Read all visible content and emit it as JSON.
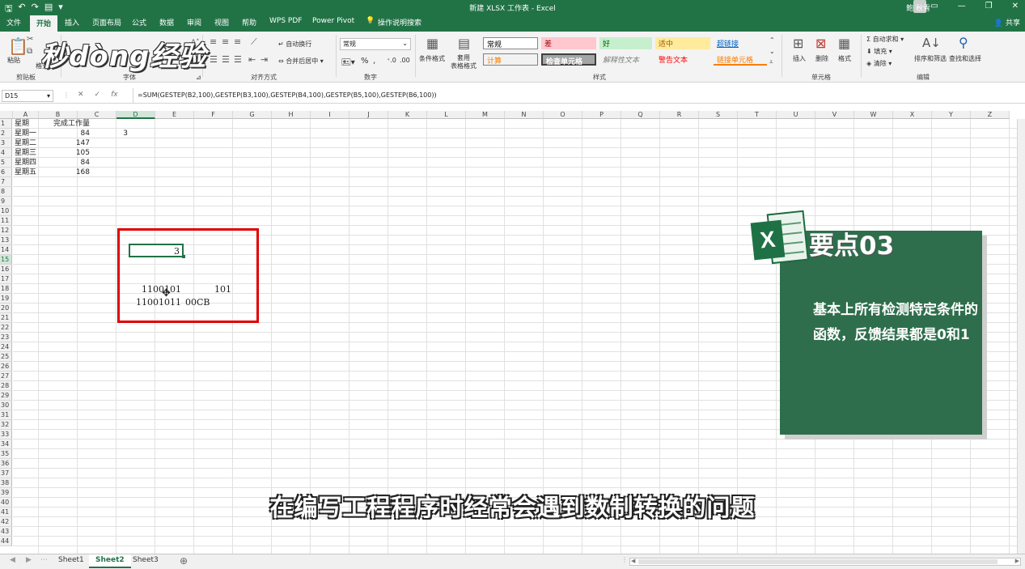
{
  "titlebar": {
    "doc_title": "新建 XLSX 工作表 - Excel",
    "user": "鲍 秋雪",
    "qat_icons": [
      "save-icon",
      "undo-icon",
      "redo-icon",
      "form-icon",
      "customize-icon"
    ]
  },
  "tabs": [
    "文件",
    "开始",
    "插入",
    "页面布局",
    "公式",
    "数据",
    "审阅",
    "视图",
    "帮助",
    "WPS PDF",
    "Power Pivot"
  ],
  "active_tab": "开始",
  "tell_me": "操作说明搜索",
  "share": "共享",
  "ribbon": {
    "groups": {
      "clipboard": "剪贴板",
      "font": "字体",
      "alignment": "对齐方式",
      "number": "数字",
      "styles": "样式",
      "cells": "单元格",
      "editing": "编辑"
    },
    "paste": "粘贴",
    "format_painter": "格式刷",
    "wrap_text": "自动换行",
    "merge_center": "合并后居中",
    "number_format": "常规",
    "conditional_format": "条件格式",
    "table_format": "套用\n表格格式",
    "style_cells": [
      {
        "label": "常规",
        "bg": "#ffffff",
        "color": "#000000"
      },
      {
        "label": "差",
        "bg": "#ffc7ce",
        "color": "#9c0006"
      },
      {
        "label": "好",
        "bg": "#c6efce",
        "color": "#006100"
      },
      {
        "label": "适中",
        "bg": "#ffeb9c",
        "color": "#9c5700"
      },
      {
        "label": "超链接",
        "bg": "#f3f3f3",
        "color": "#0563c1"
      },
      {
        "label": "计算",
        "bg": "#f2f2f2",
        "color": "#fa7d00"
      },
      {
        "label": "检查单元格",
        "bg": "#a5a5a5",
        "color": "#ffffff"
      },
      {
        "label": "解释性文本",
        "bg": "#f3f3f3",
        "color": "#7f7f7f"
      },
      {
        "label": "警告文本",
        "bg": "#f3f3f3",
        "color": "#ff0000"
      },
      {
        "label": "链接单元格",
        "bg": "#f3f3f3",
        "color": "#fa7d00"
      }
    ],
    "insert": "插入",
    "delete": "删除",
    "format": "格式",
    "autosum": "自动求和",
    "fill": "填充",
    "clear": "清除",
    "sort_filter": "排序和筛选",
    "find_select": "查找和选择"
  },
  "watermark": "秒dòng经验",
  "formula_bar": {
    "name_box": "D15",
    "formula": "=SUM(GESTEP(B2,100),GESTEP(B3,100),GESTEP(B4,100),GESTEP(B5,100),GESTEP(B6,100))"
  },
  "columns": [
    "A",
    "B",
    "C",
    "D",
    "E",
    "F",
    "G",
    "H",
    "I",
    "J",
    "K",
    "L",
    "M",
    "N",
    "O",
    "P",
    "Q",
    "R",
    "S",
    "T",
    "U",
    "V",
    "W",
    "X",
    "Y",
    "Z"
  ],
  "cells": {
    "a1": "星期",
    "b1": "完成工作量",
    "a2": "星期一",
    "b2": "84",
    "c2": "3",
    "a3": "星期二",
    "b3": "147",
    "a4": "星期三",
    "b4": "105",
    "a5": "星期四",
    "b5": "84",
    "a6": "星期五",
    "b6": "168",
    "d14": "3",
    "d18": "1100101",
    "f18": "101",
    "d19": "11001011",
    "e19": "00CB"
  },
  "card": {
    "heading": "要点03",
    "text": "基本上所有检测特定条件的函数，反馈结果都是0和1",
    "color": "#2e6e4c"
  },
  "subtitle": "在编写工程程序时经常会遇到数制转换的问题",
  "sheets": [
    "Sheet1",
    "Sheet2",
    "Sheet3"
  ],
  "active_sheet": "Sheet2",
  "accent": "#217346"
}
